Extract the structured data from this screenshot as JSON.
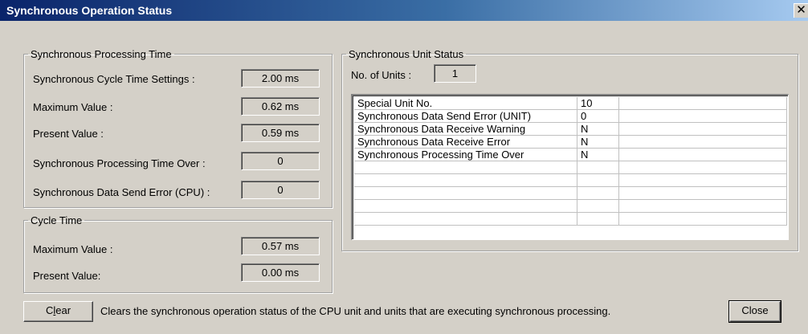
{
  "window": {
    "title": "Synchronous Operation Status",
    "close_glyph": "✕"
  },
  "sync_processing": {
    "legend": "Synchronous Processing Time",
    "rows": [
      {
        "label": "Synchronous Cycle Time Settings :",
        "value": "2.00 ms"
      },
      {
        "label": "Maximum Value :",
        "value": "0.62 ms"
      },
      {
        "label": "Present Value :",
        "value": "0.59 ms"
      },
      {
        "label": "Synchronous Processing Time Over :",
        "value": "0"
      },
      {
        "label": "Synchronous Data Send Error (CPU) :",
        "value": "0"
      }
    ]
  },
  "cycle_time": {
    "legend": "Cycle Time",
    "rows": [
      {
        "label": "Maximum Value :",
        "value": "0.57 ms"
      },
      {
        "label": "Present Value:",
        "value": "0.00 ms"
      }
    ]
  },
  "unit_status": {
    "legend": "Synchronous Unit Status",
    "units_label": "No. of Units :",
    "units_value": "1",
    "table": [
      [
        "Special Unit No.",
        "10",
        ""
      ],
      [
        "Synchronous Data Send Error (UNIT)",
        "0",
        ""
      ],
      [
        "Synchronous Data Receive Warning",
        "N",
        ""
      ],
      [
        "Synchronous Data Receive Error",
        "N",
        ""
      ],
      [
        "Synchronous Processing Time Over",
        "N",
        ""
      ],
      [
        "",
        "",
        ""
      ],
      [
        "",
        "",
        ""
      ],
      [
        "",
        "",
        ""
      ],
      [
        "",
        "",
        ""
      ],
      [
        "",
        "",
        ""
      ]
    ]
  },
  "footer": {
    "clear_pre": "C",
    "clear_accel": "l",
    "clear_post": "ear",
    "description": "Clears the synchronous operation status of the CPU unit and units that are executing synchronous processing.",
    "close_label": "Close"
  }
}
